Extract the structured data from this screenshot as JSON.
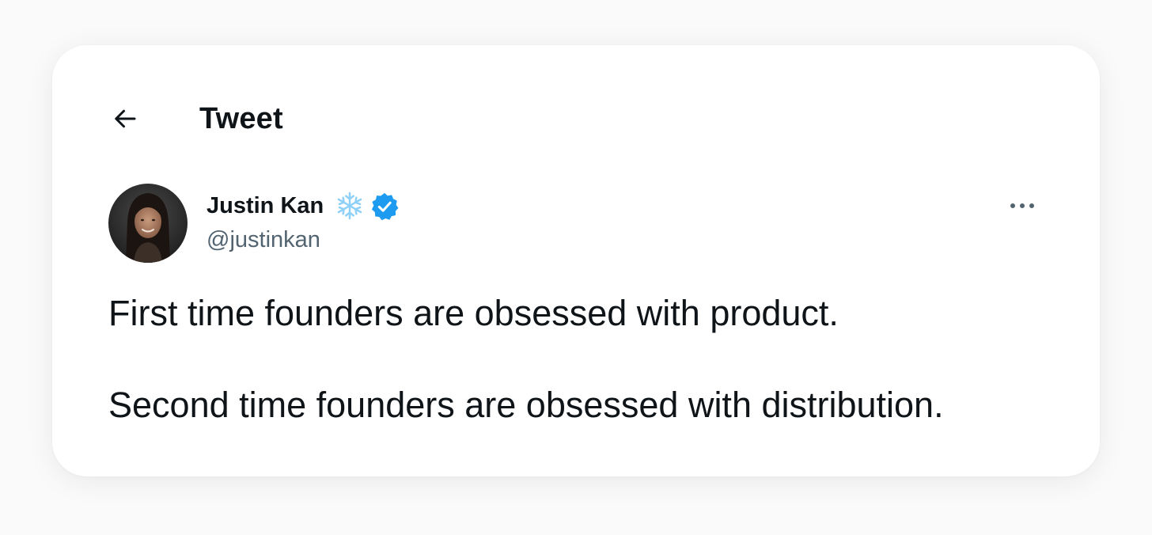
{
  "header": {
    "title": "Tweet"
  },
  "author": {
    "display_name": "Justin Kan",
    "handle": "@justinkan",
    "name_emoji": "snowflake-icon",
    "verified": true
  },
  "tweet": {
    "lines": [
      "First time founders are obsessed with product.",
      "Second time founders are obsessed with distribution."
    ]
  },
  "colors": {
    "text_primary": "#0f1419",
    "text_secondary": "#536471",
    "verified_blue": "#1d9bf0",
    "snowflake_blue": "#8ed0f7",
    "card_background": "#ffffff",
    "page_background": "#fafafa"
  }
}
